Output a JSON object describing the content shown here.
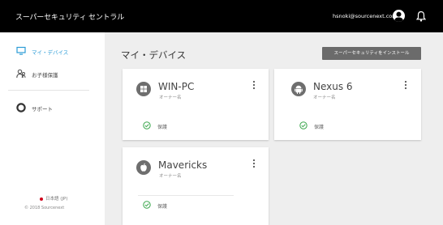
{
  "header": {
    "app_title": "スーパーセキュリティ セントラル",
    "user_email": "hsnoki@sourcenext.com"
  },
  "sidebar": {
    "items": [
      {
        "label": "マイ・デバイス",
        "icon": "monitor-icon",
        "active": true
      },
      {
        "label": "お子様保護",
        "icon": "child-icon",
        "active": false
      },
      {
        "label": "サポート",
        "icon": "support-icon",
        "active": false
      }
    ],
    "language": "日本語 (JP)",
    "copyright": "© 2018 Sourcenext"
  },
  "main": {
    "title": "マイ・デバイス",
    "install_button": "スーパーセキュリティをインストール",
    "devices": [
      {
        "name": "WIN-PC",
        "owner": "オーナー名",
        "os": "windows-icon",
        "status": "保護"
      },
      {
        "name": "Nexus 6",
        "owner": "オーナー名",
        "os": "android-icon",
        "status": "保護"
      },
      {
        "name": "Mavericks",
        "owner": "オーナー名",
        "os": "apple-icon",
        "status": "保護"
      }
    ]
  },
  "colors": {
    "topbar": "#000000",
    "active_nav": "#2a9bd6",
    "status_ok": "#3aa64c",
    "install_button": "#6b6b6b"
  }
}
